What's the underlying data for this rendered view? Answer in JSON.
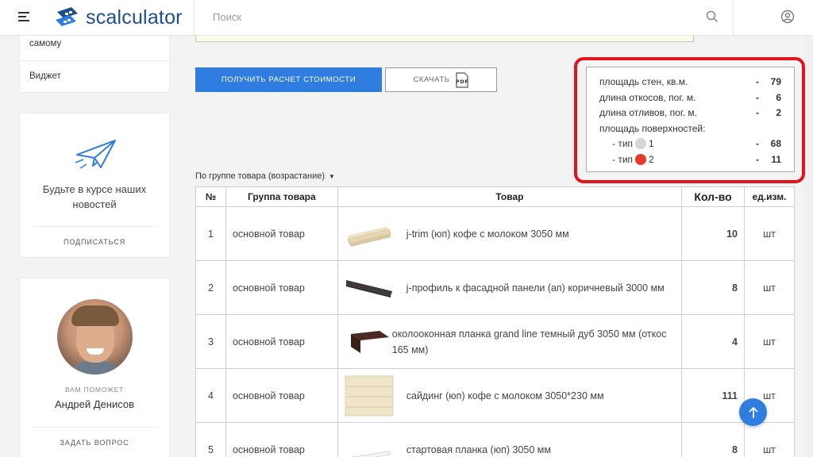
{
  "header": {
    "logo_text": "scalculator",
    "search_placeholder": "Поиск",
    "icons": [
      "menu-icon",
      "search-icon",
      "user-icon"
    ]
  },
  "sidebar": {
    "menu_items": [
      "самому",
      "Виджет"
    ],
    "subscribe": {
      "text": "Будьте в курсе наших новостей",
      "button": "ПОДПИСАТЬСЯ"
    },
    "consultant": {
      "help_label": "ВАМ ПОМОЖЕТ",
      "name": "Андрей Денисов",
      "ask_button": "ЗАДАТЬ ВОПРОС"
    }
  },
  "actions": {
    "calc_button": "ПОЛУЧИТЬ РАСЧЕТ СТОИМОСТИ",
    "download_button": "СКАЧАТЬ",
    "pdf_icon_label": "PDF"
  },
  "summary": {
    "rows": [
      {
        "label": "площадь стен, кв.м.",
        "dash": "-",
        "value": "79"
      },
      {
        "label": "длина откосов, пог. м.",
        "dash": "-",
        "value": "6"
      },
      {
        "label": "длина отливов, пог. м.",
        "dash": "-",
        "value": "2"
      }
    ],
    "surfaces_label": "площадь поверхностей:",
    "types": [
      {
        "prefix": "- тип",
        "num": "1",
        "dash": "-",
        "value": "68",
        "color": "#d6d6d6"
      },
      {
        "prefix": "- тип",
        "num": "2",
        "dash": "-",
        "value": "11",
        "color": "#e53b2c"
      }
    ],
    "highlight_color": "#e3131b"
  },
  "sort": {
    "label": "По группе товара (возрастание)"
  },
  "table": {
    "headers": [
      "№",
      "Группа товара",
      "Товар",
      "Кол-во",
      "ед.изм."
    ],
    "rows": [
      {
        "n": "1",
        "group": "основной товар",
        "product": "j-trim (юп) кофе с молоком 3050 мм",
        "qty": "10",
        "unit": "шт"
      },
      {
        "n": "2",
        "group": "основной товар",
        "product": "j-профиль к фасадной панели (ап) коричневый 3000 мм",
        "qty": "8",
        "unit": "шт"
      },
      {
        "n": "3",
        "group": "основной товар",
        "product": "околооконная планка grand line темный дуб 3050 мм (откос 165 мм)",
        "qty": "4",
        "unit": "шт"
      },
      {
        "n": "4",
        "group": "основной товар",
        "product": "сайдинг (юп) кофе с молоком 3050*230 мм",
        "qty": "111",
        "unit": "шт"
      },
      {
        "n": "5",
        "group": "основной товар",
        "product": "стартовая планка (юп) 3050 мм",
        "qty": "8",
        "unit": "шт"
      }
    ]
  },
  "colors": {
    "accent": "#2f7de1",
    "logo": "#1d4f8f"
  }
}
